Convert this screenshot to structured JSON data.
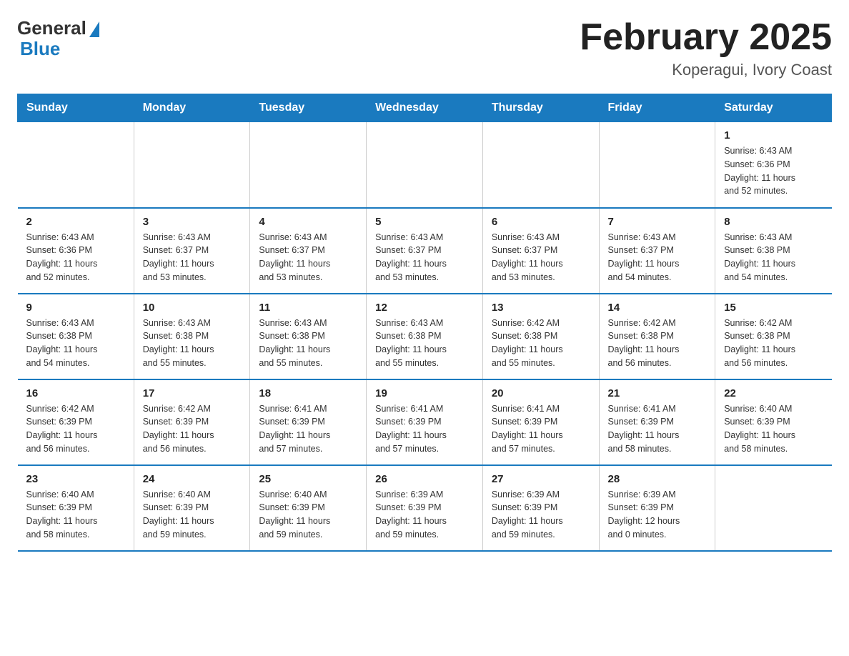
{
  "header": {
    "logo_general": "General",
    "logo_blue": "Blue",
    "title": "February 2025",
    "location": "Koperagui, Ivory Coast"
  },
  "weekdays": [
    "Sunday",
    "Monday",
    "Tuesday",
    "Wednesday",
    "Thursday",
    "Friday",
    "Saturday"
  ],
  "weeks": [
    [
      {
        "day": "",
        "info": ""
      },
      {
        "day": "",
        "info": ""
      },
      {
        "day": "",
        "info": ""
      },
      {
        "day": "",
        "info": ""
      },
      {
        "day": "",
        "info": ""
      },
      {
        "day": "",
        "info": ""
      },
      {
        "day": "1",
        "info": "Sunrise: 6:43 AM\nSunset: 6:36 PM\nDaylight: 11 hours\nand 52 minutes."
      }
    ],
    [
      {
        "day": "2",
        "info": "Sunrise: 6:43 AM\nSunset: 6:36 PM\nDaylight: 11 hours\nand 52 minutes."
      },
      {
        "day": "3",
        "info": "Sunrise: 6:43 AM\nSunset: 6:37 PM\nDaylight: 11 hours\nand 53 minutes."
      },
      {
        "day": "4",
        "info": "Sunrise: 6:43 AM\nSunset: 6:37 PM\nDaylight: 11 hours\nand 53 minutes."
      },
      {
        "day": "5",
        "info": "Sunrise: 6:43 AM\nSunset: 6:37 PM\nDaylight: 11 hours\nand 53 minutes."
      },
      {
        "day": "6",
        "info": "Sunrise: 6:43 AM\nSunset: 6:37 PM\nDaylight: 11 hours\nand 53 minutes."
      },
      {
        "day": "7",
        "info": "Sunrise: 6:43 AM\nSunset: 6:37 PM\nDaylight: 11 hours\nand 54 minutes."
      },
      {
        "day": "8",
        "info": "Sunrise: 6:43 AM\nSunset: 6:38 PM\nDaylight: 11 hours\nand 54 minutes."
      }
    ],
    [
      {
        "day": "9",
        "info": "Sunrise: 6:43 AM\nSunset: 6:38 PM\nDaylight: 11 hours\nand 54 minutes."
      },
      {
        "day": "10",
        "info": "Sunrise: 6:43 AM\nSunset: 6:38 PM\nDaylight: 11 hours\nand 55 minutes."
      },
      {
        "day": "11",
        "info": "Sunrise: 6:43 AM\nSunset: 6:38 PM\nDaylight: 11 hours\nand 55 minutes."
      },
      {
        "day": "12",
        "info": "Sunrise: 6:43 AM\nSunset: 6:38 PM\nDaylight: 11 hours\nand 55 minutes."
      },
      {
        "day": "13",
        "info": "Sunrise: 6:42 AM\nSunset: 6:38 PM\nDaylight: 11 hours\nand 55 minutes."
      },
      {
        "day": "14",
        "info": "Sunrise: 6:42 AM\nSunset: 6:38 PM\nDaylight: 11 hours\nand 56 minutes."
      },
      {
        "day": "15",
        "info": "Sunrise: 6:42 AM\nSunset: 6:38 PM\nDaylight: 11 hours\nand 56 minutes."
      }
    ],
    [
      {
        "day": "16",
        "info": "Sunrise: 6:42 AM\nSunset: 6:39 PM\nDaylight: 11 hours\nand 56 minutes."
      },
      {
        "day": "17",
        "info": "Sunrise: 6:42 AM\nSunset: 6:39 PM\nDaylight: 11 hours\nand 56 minutes."
      },
      {
        "day": "18",
        "info": "Sunrise: 6:41 AM\nSunset: 6:39 PM\nDaylight: 11 hours\nand 57 minutes."
      },
      {
        "day": "19",
        "info": "Sunrise: 6:41 AM\nSunset: 6:39 PM\nDaylight: 11 hours\nand 57 minutes."
      },
      {
        "day": "20",
        "info": "Sunrise: 6:41 AM\nSunset: 6:39 PM\nDaylight: 11 hours\nand 57 minutes."
      },
      {
        "day": "21",
        "info": "Sunrise: 6:41 AM\nSunset: 6:39 PM\nDaylight: 11 hours\nand 58 minutes."
      },
      {
        "day": "22",
        "info": "Sunrise: 6:40 AM\nSunset: 6:39 PM\nDaylight: 11 hours\nand 58 minutes."
      }
    ],
    [
      {
        "day": "23",
        "info": "Sunrise: 6:40 AM\nSunset: 6:39 PM\nDaylight: 11 hours\nand 58 minutes."
      },
      {
        "day": "24",
        "info": "Sunrise: 6:40 AM\nSunset: 6:39 PM\nDaylight: 11 hours\nand 59 minutes."
      },
      {
        "day": "25",
        "info": "Sunrise: 6:40 AM\nSunset: 6:39 PM\nDaylight: 11 hours\nand 59 minutes."
      },
      {
        "day": "26",
        "info": "Sunrise: 6:39 AM\nSunset: 6:39 PM\nDaylight: 11 hours\nand 59 minutes."
      },
      {
        "day": "27",
        "info": "Sunrise: 6:39 AM\nSunset: 6:39 PM\nDaylight: 11 hours\nand 59 minutes."
      },
      {
        "day": "28",
        "info": "Sunrise: 6:39 AM\nSunset: 6:39 PM\nDaylight: 12 hours\nand 0 minutes."
      },
      {
        "day": "",
        "info": ""
      }
    ]
  ]
}
